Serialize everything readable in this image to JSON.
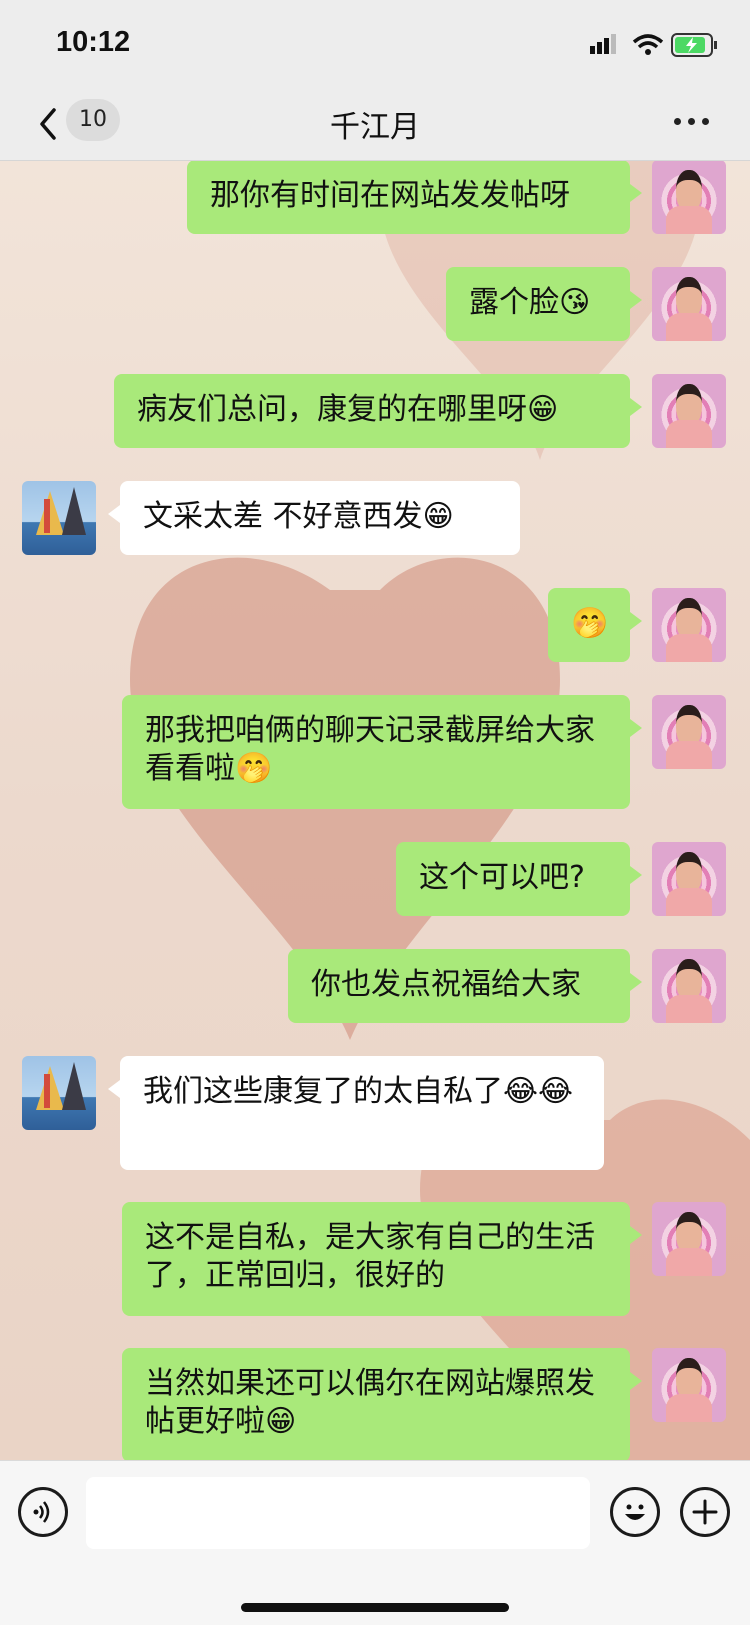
{
  "status_bar": {
    "time": "10:12",
    "battery": "charging"
  },
  "nav": {
    "unread_count": "10",
    "title": "千江月"
  },
  "messages": [
    {
      "from": "me",
      "text": "那你有时间在网站发发帖呀"
    },
    {
      "from": "me",
      "text": "露个脸😘"
    },
    {
      "from": "me",
      "text": "病友们总问，康复的在哪里呀😁"
    },
    {
      "from": "other",
      "text": "文采太差  不好意西发😁"
    },
    {
      "from": "me",
      "text": "🤭"
    },
    {
      "from": "me",
      "text": "那我把咱俩的聊天记录截屏给大家看看啦🤭"
    },
    {
      "from": "me",
      "text": "这个可以吧?"
    },
    {
      "from": "me",
      "text": "你也发点祝福给大家"
    },
    {
      "from": "other",
      "text": "我们这些康复了的太自私了😂😂"
    },
    {
      "from": "me",
      "text": "这不是自私，是大家有自己的生活了，正常回归，很好的"
    },
    {
      "from": "me",
      "text": "当然如果还可以偶尔在网站爆照发帖更好啦😁"
    }
  ],
  "input": {
    "placeholder": ""
  },
  "icons": {
    "back": "chevron-left-icon",
    "more": "more-dots-icon",
    "voice": "voice-icon",
    "emoji": "emoji-icon",
    "plus": "plus-icon"
  },
  "colors": {
    "bubble_me": "#a9e97a",
    "bubble_other": "#ffffff",
    "header_bg": "#ededed"
  }
}
